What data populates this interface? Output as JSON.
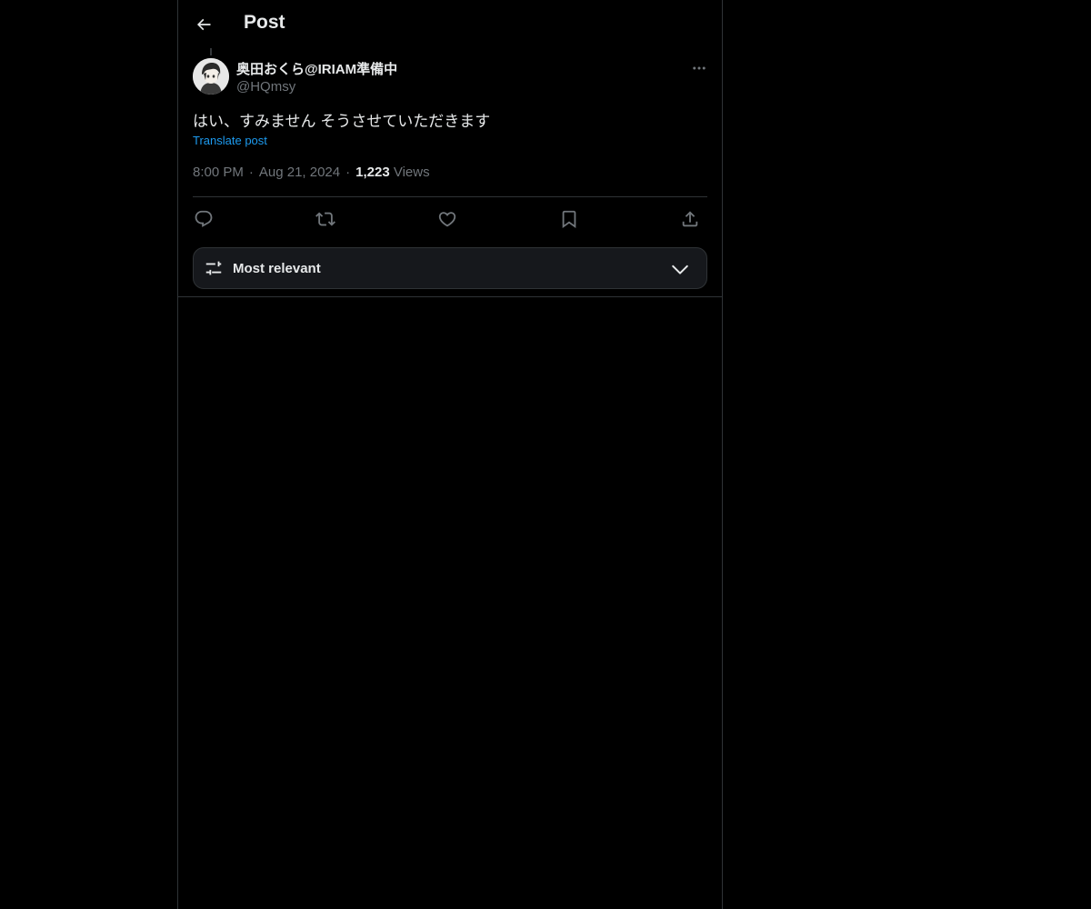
{
  "header": {
    "back_icon": "arrow-left-icon",
    "title": "Post"
  },
  "post": {
    "author": {
      "display_name": "奥田おくら@IRIAM準備中",
      "handle": "@HQmsy",
      "avatar": "avatar-image"
    },
    "more_icon": "more-horizontal-icon",
    "text": "はい、すみません そうさせていただきます",
    "translate_label": "Translate post",
    "time": "8:00 PM",
    "date": "Aug 21, 2024",
    "views_count": "1,223",
    "views_label": "Views",
    "separator": "·"
  },
  "actions": [
    {
      "name": "reply",
      "icon": "reply-icon"
    },
    {
      "name": "repost",
      "icon": "repost-icon"
    },
    {
      "name": "like",
      "icon": "heart-icon"
    },
    {
      "name": "bookmark",
      "icon": "bookmark-icon"
    },
    {
      "name": "share",
      "icon": "share-icon"
    }
  ],
  "sort": {
    "icon": "sliders-icon",
    "label": "Most relevant",
    "chevron": "chevron-down-icon"
  },
  "colors": {
    "background": "#000000",
    "text": "#e7e9ea",
    "muted": "#71767b",
    "link": "#1d9bf0",
    "border": "#2f3336"
  }
}
